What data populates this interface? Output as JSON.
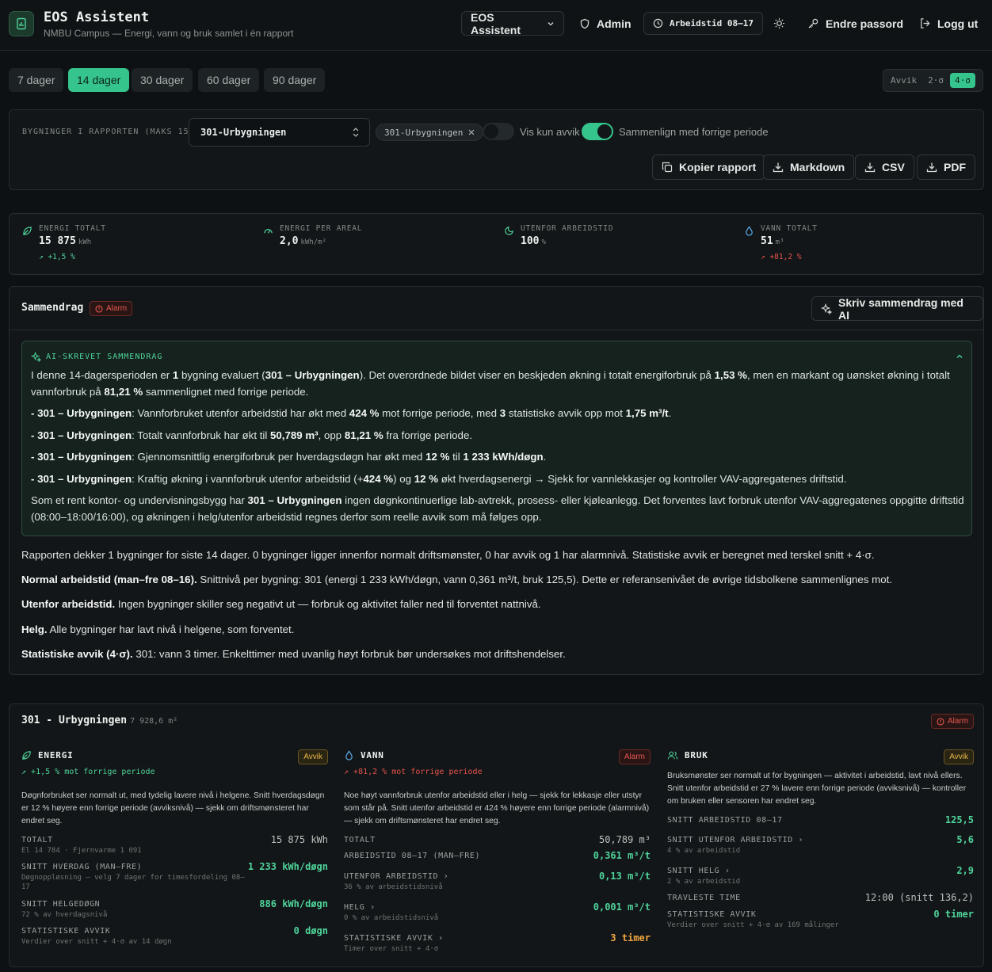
{
  "header": {
    "title": "EOS Assistent",
    "subtitle": "NMBU Campus — Energi, vann og bruk samlet i én rapport",
    "assistant_select": "EOS Assistent",
    "admin": "Admin",
    "worktime": "Arbeidstid 08–17",
    "change_password": "Endre passord",
    "logout": "Logg ut"
  },
  "periods": [
    "7 dager",
    "14 dager",
    "30 dager",
    "60 dager",
    "90 dager"
  ],
  "active_period": "14 dager",
  "threshold": {
    "label": "Avvik",
    "options": [
      "2·σ",
      "4·σ"
    ],
    "selected": "4·σ"
  },
  "filter": {
    "label": "BYGNINGER I RAPPORTEN (MAKS 15)",
    "selected": "301-Urbygningen",
    "chip": "301-Urbygningen",
    "only_deviations": "Vis kun avvik",
    "only_deviations_on": false,
    "compare": "Sammenlign med forrige periode",
    "compare_on": true,
    "actions": [
      "Kopier rapport",
      "Markdown",
      "CSV",
      "PDF"
    ]
  },
  "kpis": [
    {
      "label": "ENERGI TOTALT",
      "value": "15 875",
      "unit": "kWh",
      "delta": "+1,5 %",
      "delta_color": "green",
      "icon": "leaf-icon"
    },
    {
      "label": "ENERGI PER AREAL",
      "value": "2,0",
      "unit": "kWh/m²",
      "delta": "",
      "icon": "gauge-icon"
    },
    {
      "label": "UTENFOR ARBEIDSTID",
      "value": "100",
      "unit": "%",
      "delta": "",
      "icon": "moon-icon"
    },
    {
      "label": "VANN TOTALT",
      "value": "51",
      "unit": "m³",
      "delta": "+81,2 %",
      "delta_color": "red",
      "icon": "drop-icon"
    }
  ],
  "summary": {
    "title": "Sammendrag",
    "badge": "Alarm",
    "ai_button": "Skriv sammendrag med AI",
    "ai_label": "AI-SKREVET SAMMENDRAG",
    "ai_paragraphs": [
      "I denne 14-dagersperioden er <b>1</b> bygning evaluert (<b>301 – Urbygningen</b>). Det overordnede bildet viser en beskjeden økning i totalt energiforbruk på <b>1,53 %</b>, men en markant og uønsket økning i totalt vannforbruk på <b>81,21 %</b> sammenlignet med forrige periode.",
      "<b>- 301 – Urbygningen</b>: Vannforbruket utenfor arbeidstid har økt med <b>424 %</b> mot forrige periode, med <b>3</b> statistiske avvik opp mot <b>1,75 m³/t</b>.",
      "<b>- 301 – Urbygningen</b>: Totalt vannforbruk har økt til <b>50,789 m³</b>, opp <b>81,21 %</b> fra forrige periode.",
      "<b>- 301 – Urbygningen</b>: Gjennomsnittlig energiforbruk per hverdagsdøgn har økt med <b>12 %</b> til <b>1 233 kWh/døgn</b>.",
      "<b>- 301 – Urbygningen</b>: Kraftig økning i vannforbruk utenfor arbeidstid (+<b>424 %</b>) og <b>12 %</b> økt hverdagsenergi → Sjekk for vannlekkasjer og kontroller VAV-aggregatenes driftstid.",
      "Som et rent kontor- og undervisningsbygg har <b>301 – Urbygningen</b> ingen døgnkontinuerlige lab-avtrekk, prosess- eller kjøleanlegg. Det forventes lavt forbruk utenfor VAV-aggregatenes oppgitte driftstid (08:00–18:00/16:00), og økningen i helg/utenfor arbeidstid regnes derfor som reelle avvik som må følges opp."
    ],
    "report": [
      "Rapporten dekker 1 bygninger for siste 14 dager. 0 bygninger ligger innenfor normalt driftsmønster, 0 har avvik og 1 har alarmnivå. Statistiske avvik er beregnet med terskel snitt + 4·σ.",
      "<b>Normal arbeidstid (man–fre 08–16).</b> Snittnivå per bygning: 301 (energi 1 233 kWh/døgn, vann 0,361 m³/t, bruk 125,5). Dette er referansenivået de øvrige tidsbolkene sammenlignes mot.",
      "<b>Utenfor arbeidstid.</b> Ingen bygninger skiller seg negativt ut — forbruk og aktivitet faller ned til forventet nattnivå.",
      "<b>Helg.</b> Alle bygninger har lavt nivå i helgene, som forventet.",
      "<b>Statistiske avvik (4·σ).</b> 301: vann 3 timer. Enkelttimer med uvanlig høyt forbruk bør undersøkes mot driftshendelser."
    ]
  },
  "building": {
    "name": "301 - Urbygningen",
    "area": "7 928,6 m²",
    "badge": "Alarm",
    "energy": {
      "title": "ENERGI",
      "badge": "Avvik",
      "trend": "+1,5 % mot forrige periode",
      "desc": "Døgnforbruket ser normalt ut, med tydelig lavere nivå i helgene. Snitt hverdagsdøgn er 12 % høyere enn forrige periode (avviksnivå) — sjekk om driftsmønsteret har endret seg.",
      "rows": [
        {
          "k": "TOTALT",
          "s": "El 14 784 · Fjernvarme 1 091",
          "v": "15 875 kWh",
          "c": "n"
        },
        {
          "k": "SNITT HVERDAG (MAN–FRE)",
          "s": "Døgnoppløsning — velg 7 dager for timesfordeling 08–17",
          "v": "1 233 kWh/døgn",
          "c": "g"
        },
        {
          "k": "SNITT HELGEDØGN",
          "s": "72 % av hverdagsnivå",
          "v": "886 kWh/døgn",
          "c": "g"
        },
        {
          "k": "STATISTISKE AVVIK",
          "s": "Verdier over snitt + 4·σ av 14 døgn",
          "v": "0 døgn",
          "c": "g"
        }
      ]
    },
    "water": {
      "title": "VANN",
      "badge": "Alarm",
      "trend": "+81,2 % mot forrige periode",
      "desc": "Noe høyt vannforbruk utenfor arbeidstid eller i helg — sjekk for lekkasje eller utstyr som står på. Snitt utenfor arbeidstid er 424 % høyere enn forrige periode (alarmnivå) — sjekk om driftsmønsteret har endret seg.",
      "rows": [
        {
          "k": "TOTALT",
          "s": "",
          "v": "50,789 m³",
          "c": "n"
        },
        {
          "k": "ARBEIDSTID 08–17 (MAN–FRE)",
          "s": "",
          "v": "0,361 m³/t",
          "c": "g"
        },
        {
          "k": "UTENFOR ARBEIDSTID ›",
          "s": "36 % av arbeidstidsnivå",
          "v": "0,13 m³/t",
          "c": "g"
        },
        {
          "k": "HELG ›",
          "s": "0 % av arbeidstidsnivå",
          "v": "0,001 m³/t",
          "c": "g"
        },
        {
          "k": "STATISTISKE AVVIK ›",
          "s": "Timer over snitt + 4·σ",
          "v": "3 timer",
          "c": "o"
        }
      ]
    },
    "usage": {
      "title": "BRUK",
      "badge": "Avvik",
      "desc": "Bruksmønster ser normalt ut for bygningen — aktivitet i arbeidstid, lavt nivå ellers. Snitt utenfor arbeidstid er 27 % lavere enn forrige periode (avviksnivå) — kontroller om bruken eller sensoren har endret seg.",
      "rows": [
        {
          "k": "SNITT ARBEIDSTID 08–17",
          "s": "",
          "v": "125,5",
          "c": "g"
        },
        {
          "k": "SNITT UTENFOR ARBEIDSTID ›",
          "s": "4 % av arbeidstid",
          "v": "5,6",
          "c": "g"
        },
        {
          "k": "SNITT HELG ›",
          "s": "2 % av arbeidstid",
          "v": "2,9",
          "c": "g"
        },
        {
          "k": "TRAVLESTE TIME",
          "s": "",
          "v": "12:00 (snitt 136,2)",
          "c": "n"
        },
        {
          "k": "STATISTISKE AVVIK",
          "s": "Verdier over snitt + 4·σ av 169 målinger",
          "v": "0 timer",
          "c": "g"
        }
      ]
    }
  },
  "colors": {
    "accent": "#35c48c",
    "alarm": "#e5534b",
    "warn": "#e8b94a",
    "bg": "#0e1113"
  }
}
